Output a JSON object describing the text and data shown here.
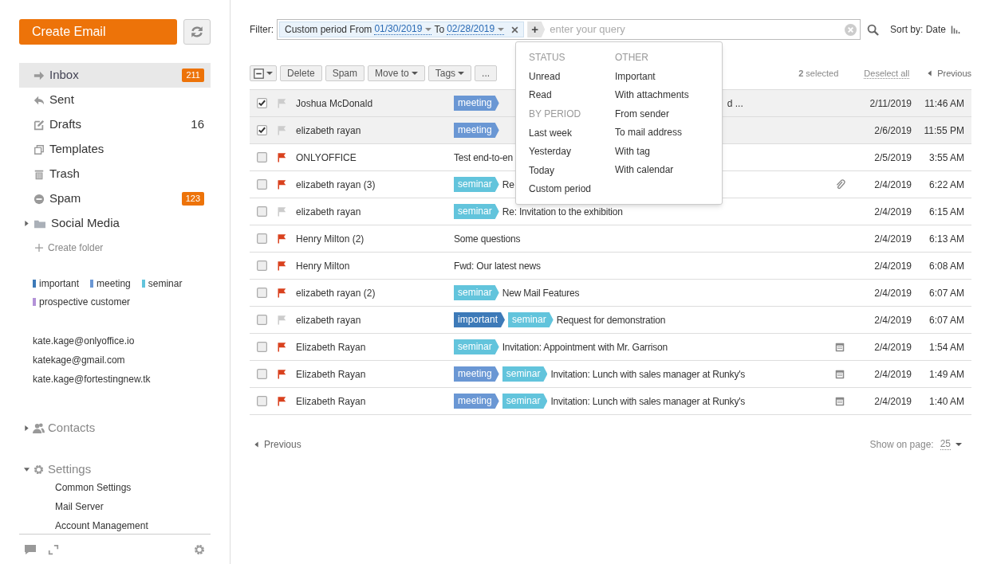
{
  "sidebar": {
    "create_button": "Create Email",
    "folders": [
      {
        "kind": "inbox",
        "label": "Inbox",
        "count": "211",
        "badge": true,
        "selected": true
      },
      {
        "kind": "sent",
        "label": "Sent",
        "selected": false
      },
      {
        "kind": "drafts",
        "label": "Drafts",
        "count": "16",
        "badge": false,
        "selected": false
      },
      {
        "kind": "templates",
        "label": "Templates",
        "selected": false
      },
      {
        "kind": "trash",
        "label": "Trash",
        "selected": false
      },
      {
        "kind": "spam",
        "label": "Spam",
        "count": "123",
        "badge": true,
        "selected": false
      },
      {
        "kind": "folder",
        "label": "Social Media",
        "expanded": false,
        "selected": false
      }
    ],
    "create_folder": "Create folder",
    "tags": [
      {
        "label": "important",
        "color": "#3d7ab8"
      },
      {
        "label": "meeting",
        "color": "#6a97d4"
      },
      {
        "label": "seminar",
        "color": "#62c4dc"
      },
      {
        "label": "prospective customer",
        "color": "#b392d8"
      }
    ],
    "accounts": [
      "kate.kage@onlyoffice.io",
      "katekage@gmail.com",
      "kate.kage@fortestingnew.tk"
    ],
    "sections": [
      {
        "kind": "contacts",
        "label": "Contacts",
        "expanded": false
      },
      {
        "kind": "settings",
        "label": "Settings",
        "expanded": true,
        "children": [
          "Common Settings",
          "Mail Server",
          "Account Management"
        ]
      }
    ]
  },
  "filter": {
    "label": "Filter:",
    "chip": {
      "name": "Custom period",
      "from_label": "From",
      "from": "01/30/2019",
      "to_label": "To",
      "to": "02/28/2019"
    },
    "add": "+",
    "placeholder": "enter your query",
    "sort": "Sort by: Date"
  },
  "toolbar": {
    "buttons": [
      "Delete",
      "Spam",
      "Move to",
      "Tags",
      "..."
    ],
    "dropdowns": [
      false,
      false,
      true,
      true,
      false
    ],
    "selected_info": "**2** selected",
    "deselect": "Deselect all",
    "previous": "Previous"
  },
  "filter_menu": [
    [
      {
        "heading": "STATUS",
        "items": [
          "Unread",
          "Read"
        ]
      },
      {
        "heading": "BY PERIOD",
        "items": [
          "Last week",
          "Yesterday",
          "Today",
          "Custom period"
        ]
      }
    ],
    [
      {
        "heading": "OTHER",
        "items": [
          "Important",
          "With attachments",
          "From sender",
          "To mail address",
          "With tag",
          "With calendar"
        ]
      }
    ]
  ],
  "messages": [
    {
      "checked": true,
      "flagged": false,
      "sender": "Joshua McDonald",
      "tags": [
        {
          "label": "meeting",
          "color": "#6a97d4"
        }
      ],
      "subject_tail": "d ...",
      "date": "2/11/2019",
      "time": "11:46 AM"
    },
    {
      "checked": true,
      "flagged": false,
      "sender": "elizabeth rayan",
      "tags": [
        {
          "label": "meeting",
          "color": "#6a97d4"
        }
      ],
      "date": "2/6/2019",
      "time": "11:55 PM"
    },
    {
      "checked": false,
      "flagged": true,
      "sender": "ONLYOFFICE",
      "subject": "Test end-to-en",
      "date": "2/5/2019",
      "time": "3:55 AM"
    },
    {
      "checked": false,
      "flagged": true,
      "sender": "elizabeth rayan (3)",
      "tags": [
        {
          "label": "seminar",
          "color": "#62c4dc"
        }
      ],
      "subject": "Re",
      "attachment": true,
      "date": "2/4/2019",
      "time": "6:22 AM"
    },
    {
      "checked": false,
      "flagged": false,
      "sender": "elizabeth rayan",
      "tags": [
        {
          "label": "seminar",
          "color": "#62c4dc"
        }
      ],
      "subject": "Re: Invitation to the exhibition",
      "date": "2/4/2019",
      "time": "6:15 AM"
    },
    {
      "checked": false,
      "flagged": true,
      "sender": "Henry Milton (2)",
      "subject": "Some questions",
      "date": "2/4/2019",
      "time": "6:13 AM"
    },
    {
      "checked": false,
      "flagged": true,
      "sender": "Henry Milton",
      "subject": "Fwd: Our latest news",
      "date": "2/4/2019",
      "time": "6:08 AM"
    },
    {
      "checked": false,
      "flagged": true,
      "sender": "elizabeth rayan (2)",
      "tags": [
        {
          "label": "seminar",
          "color": "#62c4dc"
        }
      ],
      "subject": "New Mail Features",
      "date": "2/4/2019",
      "time": "6:07 AM"
    },
    {
      "checked": false,
      "flagged": false,
      "sender": "elizabeth rayan",
      "tags": [
        {
          "label": "important",
          "color": "#3d7ab8"
        },
        {
          "label": "seminar",
          "color": "#62c4dc"
        }
      ],
      "subject": "Request for demonstration",
      "date": "2/4/2019",
      "time": "6:07 AM"
    },
    {
      "checked": false,
      "flagged": true,
      "sender": "Elizabeth Rayan",
      "tags": [
        {
          "label": "seminar",
          "color": "#62c4dc"
        }
      ],
      "subject": "Invitation: Appointment with Mr. Garrison",
      "calendar": true,
      "date": "2/4/2019",
      "time": "1:54 AM"
    },
    {
      "checked": false,
      "flagged": true,
      "sender": "Elizabeth Rayan",
      "tags": [
        {
          "label": "meeting",
          "color": "#6a97d4"
        },
        {
          "label": "seminar",
          "color": "#62c4dc"
        }
      ],
      "subject": "Invitation: Lunch with sales manager at Runky's",
      "calendar": true,
      "date": "2/4/2019",
      "time": "1:49 AM"
    },
    {
      "checked": false,
      "flagged": true,
      "sender": "Elizabeth Rayan",
      "tags": [
        {
          "label": "meeting",
          "color": "#6a97d4"
        },
        {
          "label": "seminar",
          "color": "#62c4dc"
        }
      ],
      "subject": "Invitation: Lunch with sales manager at Runky's",
      "calendar": true,
      "date": "2/4/2019",
      "time": "1:40 AM"
    }
  ],
  "pager": {
    "previous": "Previous",
    "page_size_label": "Show on page:",
    "page_size": "25"
  }
}
